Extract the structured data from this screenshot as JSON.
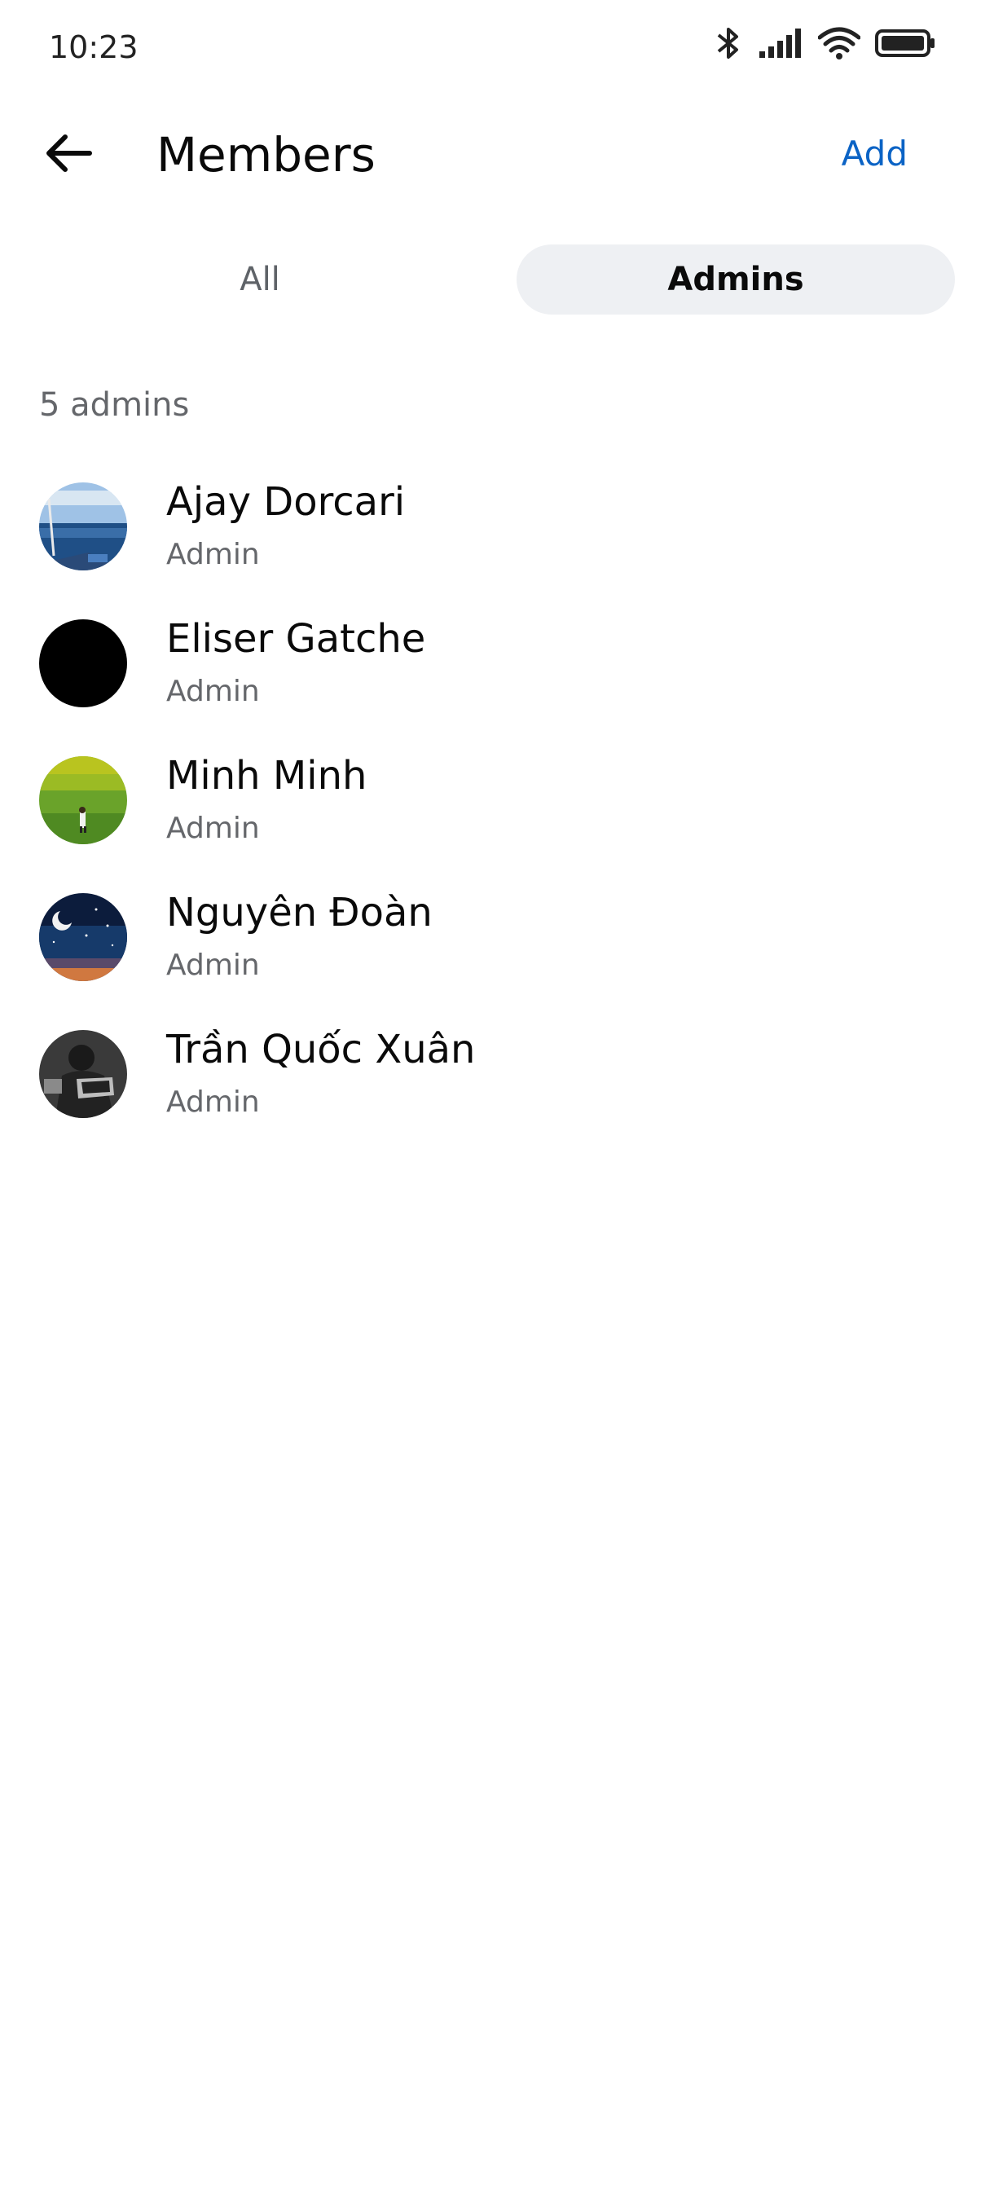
{
  "status_bar": {
    "time": "10:23",
    "icons": [
      "bluetooth-icon",
      "signal-icon",
      "wifi-icon",
      "battery-icon"
    ]
  },
  "header": {
    "title": "Members",
    "add_label": "Add",
    "back_icon": "arrow-left-icon"
  },
  "tabs": [
    {
      "label": "All",
      "selected": false
    },
    {
      "label": "Admins",
      "selected": true
    }
  ],
  "admins_count": "5 admins",
  "members": [
    {
      "name": "Ajay Dorcari",
      "role": "Admin",
      "avatar": "sea-photo"
    },
    {
      "name": "Eliser Gatche",
      "role": "Admin",
      "avatar": "black-circle"
    },
    {
      "name": "Minh Minh",
      "role": "Admin",
      "avatar": "grass-field-photo"
    },
    {
      "name": "Nguyên Đoàn",
      "role": "Admin",
      "avatar": "night-sky-photo"
    },
    {
      "name": "Trần Quốc Xuân",
      "role": "Admin",
      "avatar": "bw-person-photo"
    }
  ],
  "colors": {
    "accent": "#0b63c5",
    "tab_selected_bg": "#eef0f3",
    "secondary_text": "#65676b"
  }
}
